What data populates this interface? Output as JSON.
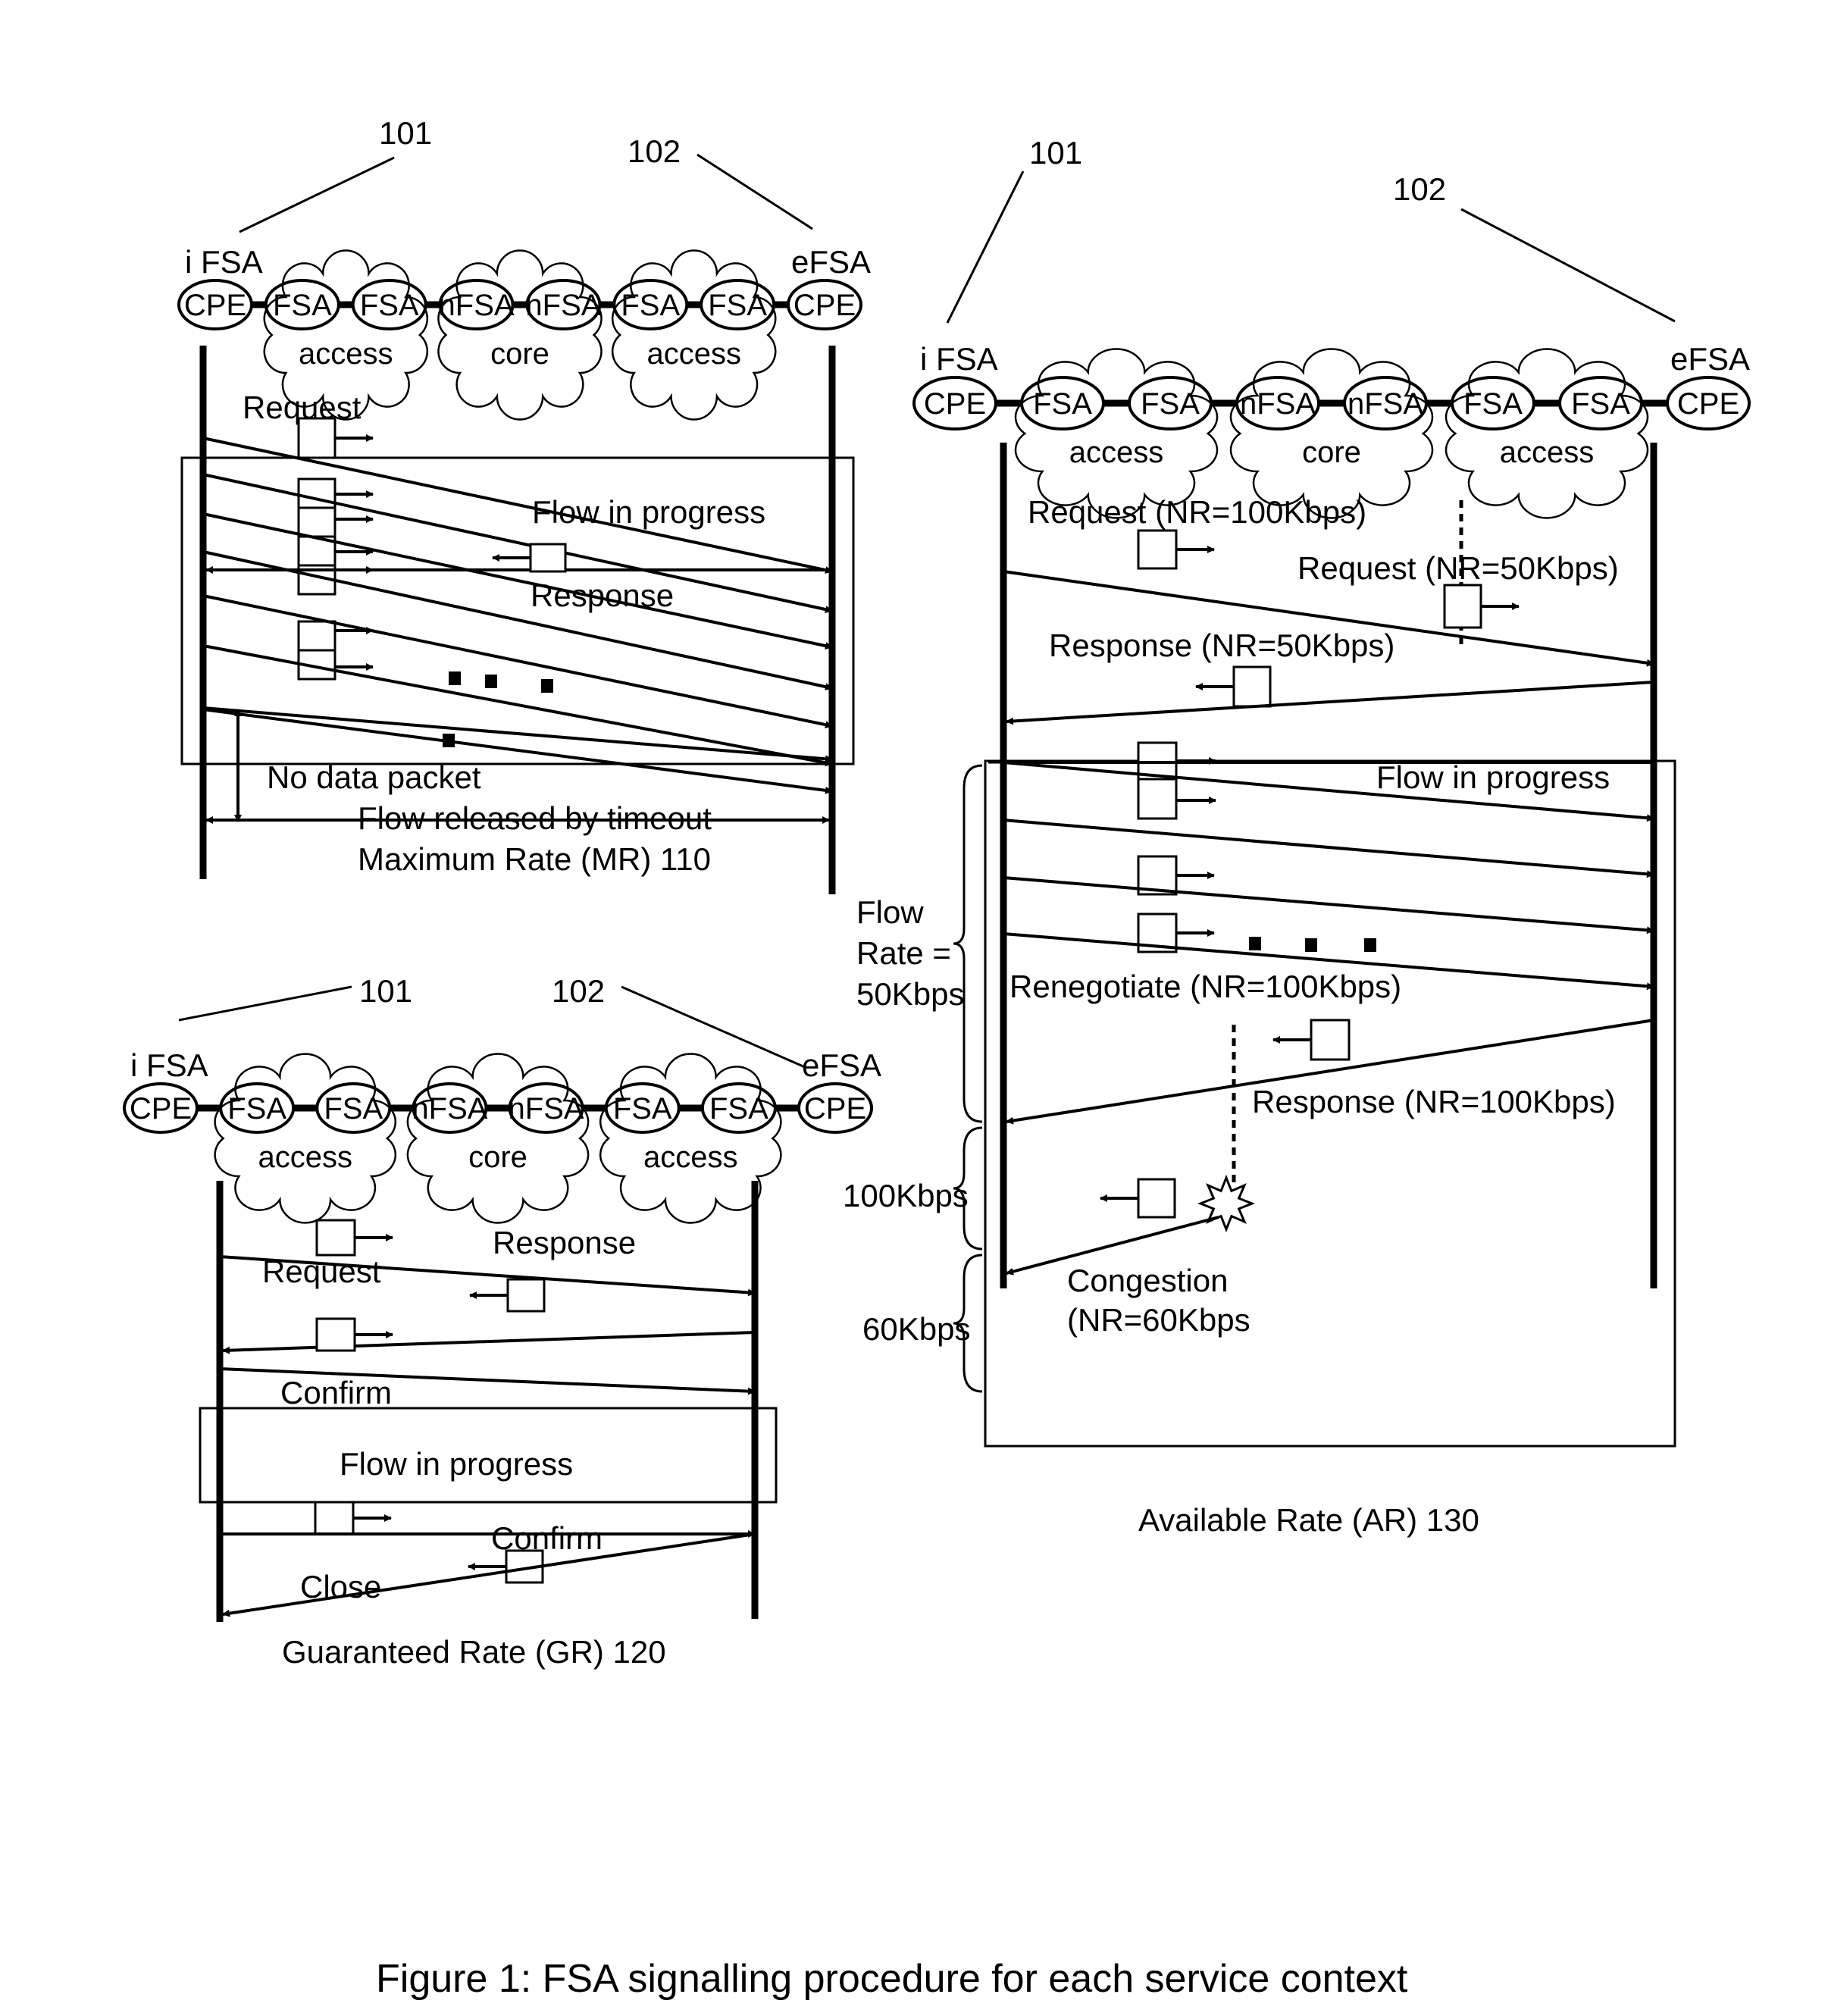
{
  "figure": {
    "caption": "Figure 1: FSA signalling procedure for each service context"
  },
  "topology": {
    "nodes": [
      "CPE",
      "FSA",
      "FSA",
      "nFSA",
      "nFSA",
      "FSA",
      "FSA",
      "CPE"
    ],
    "clouds": [
      "access",
      "core",
      "access"
    ],
    "ingress_label": "i FSA",
    "egress_label": "eFSA",
    "ref_ingress": "101",
    "ref_egress": "102"
  },
  "panels": {
    "mr": {
      "title": "Maximum Rate (MR) 110",
      "labels": {
        "request": "Request",
        "flow_in_progress": "Flow in progress",
        "response": "Response",
        "no_data_packet": "No data packet",
        "flow_released": "Flow released by timeout"
      }
    },
    "gr": {
      "title": "Guaranteed Rate (GR) 120",
      "labels": {
        "response": "Response",
        "request": "Request",
        "confirm_1": "Confirm",
        "flow_in_progress": "Flow in progress",
        "confirm_2": "Confirm",
        "close": "Close"
      }
    },
    "ar": {
      "title": "Available Rate (AR) 130",
      "labels": {
        "request_100": "Request (NR=100Kbps)",
        "request_50": "Request (NR=50Kbps)",
        "response_50": "Response (NR=50Kbps)",
        "flow_in_progress": "Flow in progress",
        "renegotiate": "Renegotiate (NR=100Kbps)",
        "response_100": "Response (NR=100Kbps)",
        "congestion_1": "Congestion",
        "congestion_2": "(NR=60Kbps"
      },
      "rate_braces": {
        "flow_rate_1": "Flow",
        "flow_rate_2": "Rate =",
        "flow_rate_3": "50Kbps",
        "rate_2": "100Kbps",
        "rate_3": "60Kbps"
      }
    }
  }
}
